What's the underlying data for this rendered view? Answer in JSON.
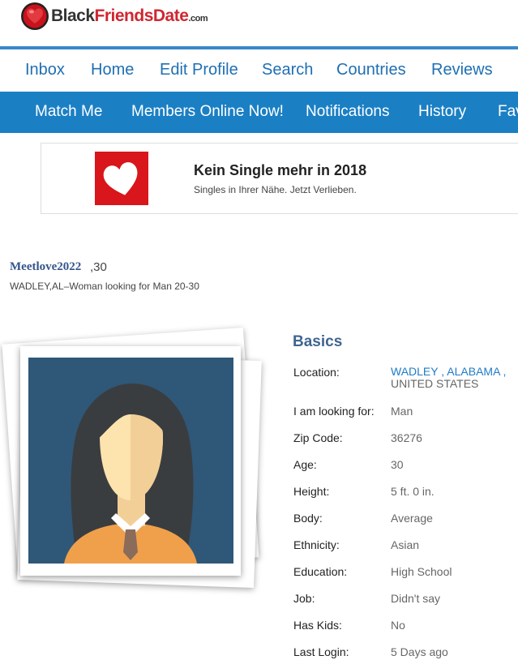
{
  "site": {
    "name_part1": "Black",
    "name_part2": "FriendsDate",
    "domain_suffix": ".com"
  },
  "nav_primary": [
    "Inbox",
    "Home",
    "Edit Profile",
    "Search",
    "Countries",
    "Reviews"
  ],
  "nav_secondary": [
    "Match Me",
    "Members Online Now!",
    "Notifications",
    "History",
    "Fav"
  ],
  "ad": {
    "title": "Kein Single mehr in 2018",
    "subtitle": "Singles in Ihrer Nähe. Jetzt Verlieben."
  },
  "profile": {
    "username": "Meetlove2022",
    "age_suffix": ",30",
    "summary": "WADLEY,AL–Woman looking for Man 20-30"
  },
  "basics": {
    "title": "Basics",
    "location": {
      "label": "Location:",
      "city": "WADLEY",
      "state": "ALABAMA",
      "country": "UNITED STATES",
      "sep1": " , ",
      "sep2": " ,"
    },
    "rows": [
      {
        "label": "I am looking for:",
        "value": "Man"
      },
      {
        "label": "Zip Code:",
        "value": "36276"
      },
      {
        "label": "Age:",
        "value": "30"
      },
      {
        "label": "Height:",
        "value": "5 ft. 0 in."
      },
      {
        "label": "Body:",
        "value": "Average"
      },
      {
        "label": "Ethnicity:",
        "value": "Asian"
      },
      {
        "label": "Education:",
        "value": "High School"
      },
      {
        "label": "Job:",
        "value": "Didn't say"
      },
      {
        "label": "Has Kids:",
        "value": "No"
      },
      {
        "label": "Last Login:",
        "value": "5 Days ago"
      }
    ]
  },
  "colors": {
    "nav_blue": "#1b7fc4",
    "link_blue": "#1f6fb3",
    "brand_red": "#d0262f"
  },
  "icons": {
    "logo": "heart-icon",
    "ad": "heart-icon",
    "avatar": "woman-avatar-placeholder"
  }
}
